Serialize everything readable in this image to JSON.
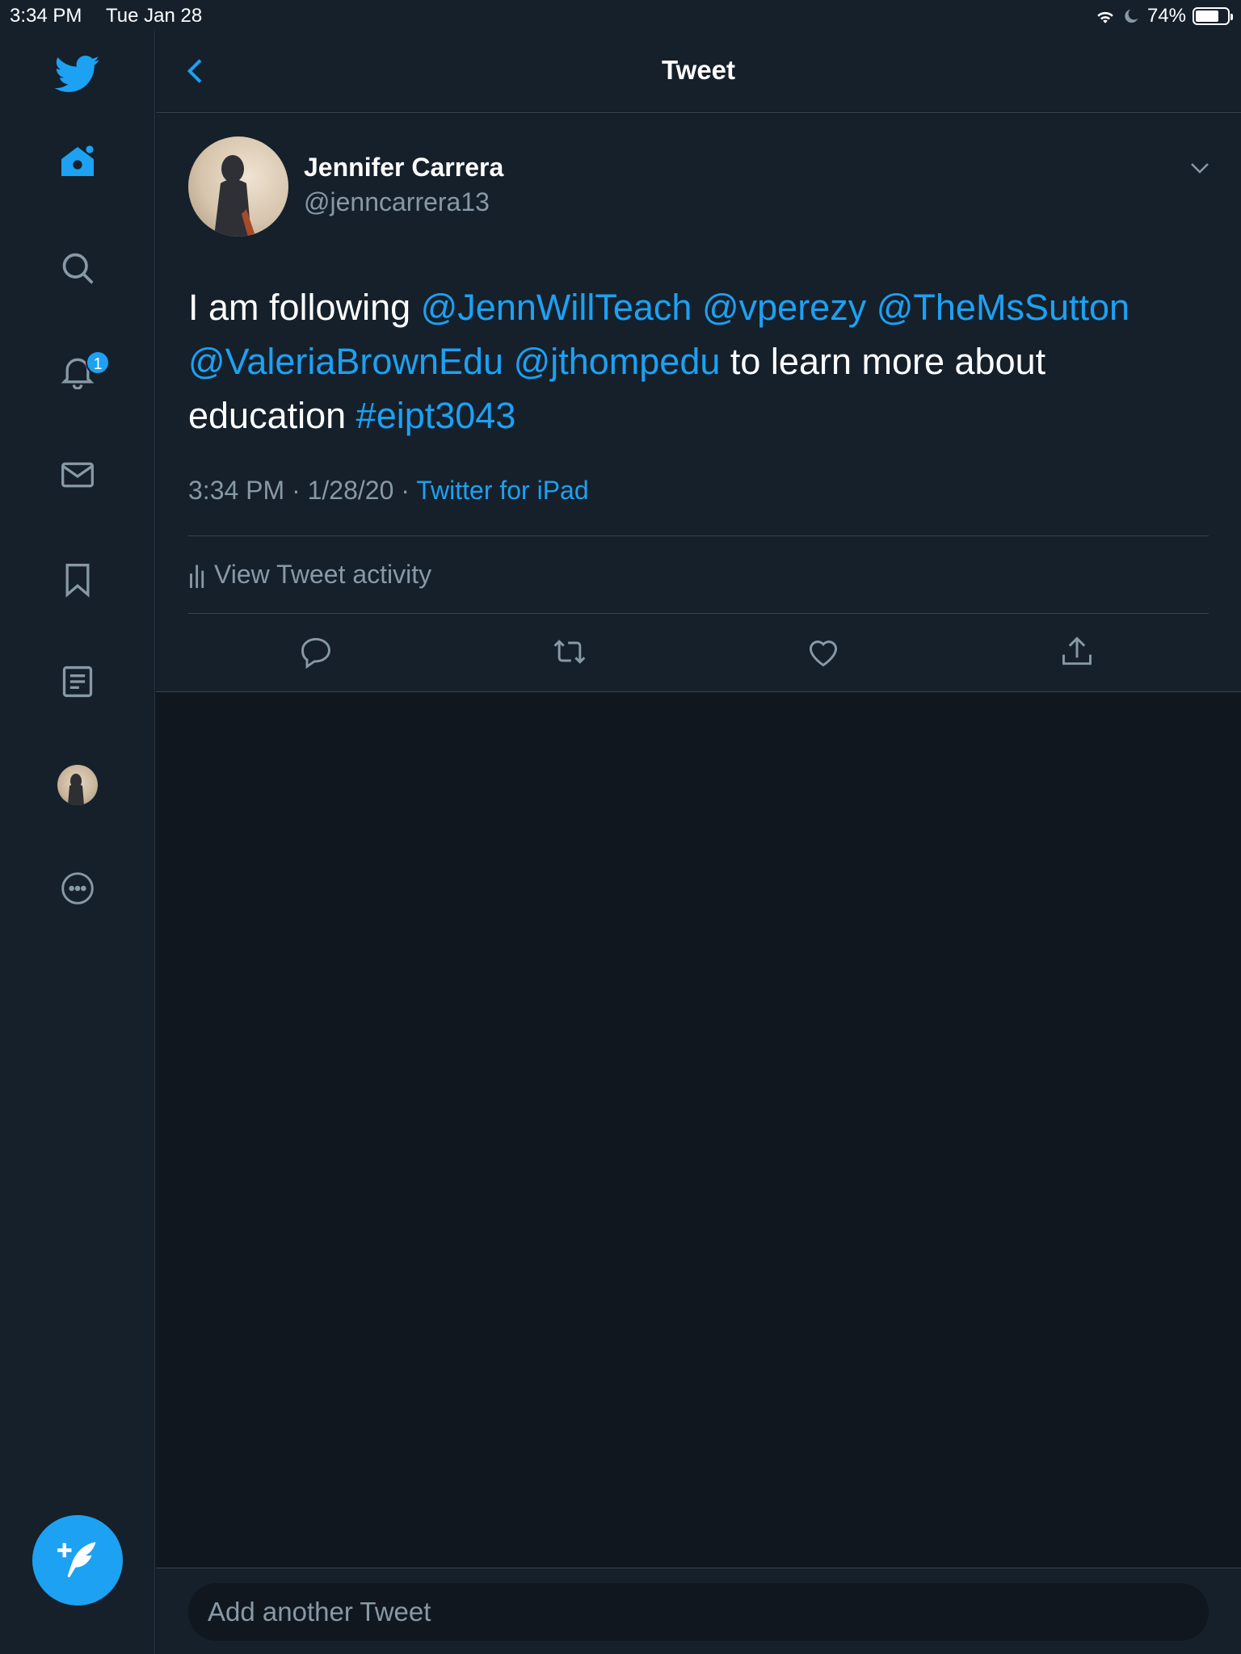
{
  "status_bar": {
    "time": "3:34 PM",
    "date": "Tue Jan 28",
    "battery_percent": "74%",
    "battery_level": 0.74
  },
  "sidebar": {
    "notification_count": "1"
  },
  "header": {
    "title": "Tweet"
  },
  "tweet": {
    "display_name": "Jennifer Carrera",
    "handle": "@jenncarrera13",
    "text_parts": [
      {
        "text": "I am following ",
        "type": "text"
      },
      {
        "text": "@JennWillTeach",
        "type": "link"
      },
      {
        "text": " ",
        "type": "text"
      },
      {
        "text": "@vperezy",
        "type": "link"
      },
      {
        "text": " ",
        "type": "text"
      },
      {
        "text": "@TheMsSutton",
        "type": "link"
      },
      {
        "text": " ",
        "type": "text"
      },
      {
        "text": "@ValeriaBrownEdu",
        "type": "link"
      },
      {
        "text": " ",
        "type": "text"
      },
      {
        "text": "@jthompedu",
        "type": "link"
      },
      {
        "text": " to learn more about education ",
        "type": "text"
      },
      {
        "text": "#eipt3043",
        "type": "link"
      }
    ],
    "timestamp": "3:34 PM · 1/28/20 · ",
    "source": "Twitter for iPad",
    "activity_label": "View Tweet activity"
  },
  "reply": {
    "placeholder": "Add another Tweet"
  },
  "colors": {
    "accent": "#1da1f2",
    "background": "#15202b",
    "muted_text": "#8899a6"
  }
}
